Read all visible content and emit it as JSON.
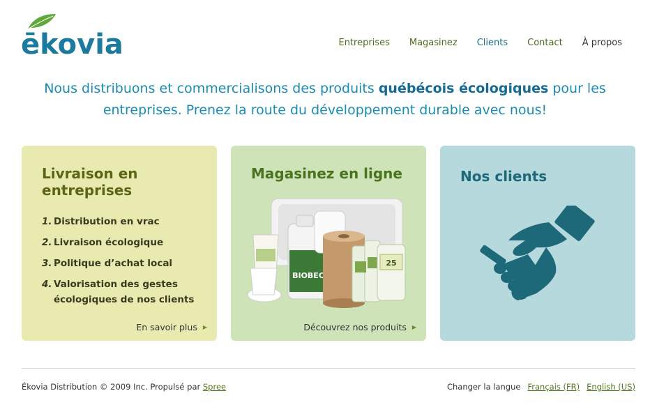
{
  "brand": {
    "logo_text": "ēkovia"
  },
  "nav": {
    "items": [
      "Entreprises",
      "Magasinez",
      "Clients",
      "Contact",
      "À propos"
    ]
  },
  "tagline": {
    "part1": "Nous distribuons et commercialisons des produits ",
    "highlight": "québécois écologiques",
    "part2": " pour les entreprises. Prenez la route du développement durable avec nous!"
  },
  "cards": {
    "delivery": {
      "title": "Livraison en entreprises",
      "steps": [
        {
          "num": "1.",
          "text": "Distribution en vrac"
        },
        {
          "num": "2.",
          "text": "Livraison écologique"
        },
        {
          "num": "3.",
          "text": "Politique d’achat local"
        },
        {
          "num": "4.",
          "text": "Valorisation des gestes écologiques  de nos clients"
        }
      ],
      "link": "En savoir plus"
    },
    "shop": {
      "title": "Magasinez en ligne",
      "link": "Découvrez nos produits",
      "product_labels": {
        "bottle": "BIOBEC",
        "bag": "25"
      }
    },
    "clients": {
      "title": "Nos clients"
    }
  },
  "footer": {
    "copyright": "Ékovia Distribution © 2009 Inc. Propulsé par ",
    "powered_link": "Spree",
    "language_label": "Changer la langue",
    "lang_fr": "Français (FR)",
    "lang_en": "English (US)"
  },
  "colors": {
    "brand_blue": "#1b7a9e",
    "leaf_green": "#5fa83a",
    "card_yellow": "#e9eab0",
    "card_green": "#cfe3b8",
    "card_blue": "#b5d9dc",
    "handshake": "#1d6879"
  },
  "icons": {
    "card_link_arrow": "triangle-right-icon",
    "clients_image": "handshake-icon"
  }
}
